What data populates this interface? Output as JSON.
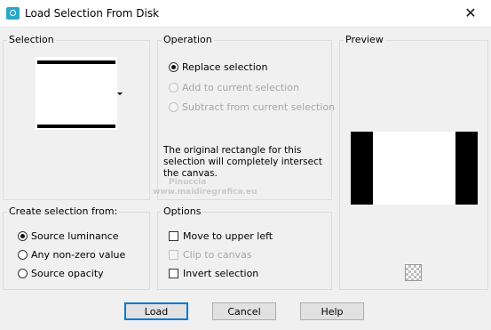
{
  "window": {
    "title": "Load Selection From Disk",
    "close_glyph": "✕"
  },
  "selection": {
    "label": "Selection"
  },
  "operation": {
    "label": "Operation",
    "options": [
      {
        "label": "Replace selection",
        "checked": true,
        "enabled": true
      },
      {
        "label": "Add to current selection",
        "checked": false,
        "enabled": false
      },
      {
        "label": "Subtract from current selection",
        "checked": false,
        "enabled": false
      }
    ],
    "info": "The original rectangle for this selection will completely intersect the canvas."
  },
  "preview": {
    "label": "Preview"
  },
  "create_from": {
    "label": "Create selection from:",
    "options": [
      {
        "label": "Source luminance",
        "checked": true
      },
      {
        "label": "Any non-zero value",
        "checked": false
      },
      {
        "label": "Source opacity",
        "checked": false
      }
    ]
  },
  "options": {
    "label": "Options",
    "items": [
      {
        "label": "Move to upper left",
        "checked": false,
        "enabled": true
      },
      {
        "label": "Clip to canvas",
        "checked": false,
        "enabled": false
      },
      {
        "label": "Invert selection",
        "checked": false,
        "enabled": true
      }
    ]
  },
  "buttons": {
    "load": "Load",
    "cancel": "Cancel",
    "help": "Help"
  },
  "watermark": {
    "name": "Pinuccia",
    "url": "www.maidiregrafica.eu"
  }
}
